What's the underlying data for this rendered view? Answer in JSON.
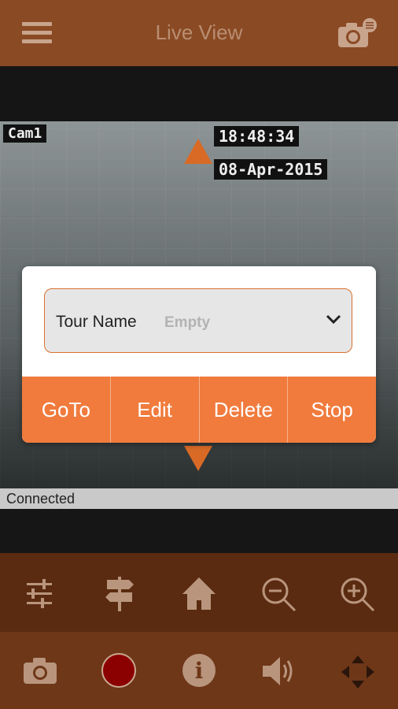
{
  "header": {
    "title": "Live View",
    "menu_icon": "hamburger-menu-icon",
    "camera_settings_icon": "camera-settings-icon"
  },
  "video": {
    "camera_name": "Cam1",
    "time": "18:48:34",
    "date": "08-Apr-2015"
  },
  "status": {
    "text": "Connected"
  },
  "dialog": {
    "tour_label": "Tour Name",
    "tour_value": "Empty",
    "buttons": {
      "goto": "GoTo",
      "edit": "Edit",
      "delete": "Delete",
      "stop": "Stop"
    }
  },
  "toolbar_top": [
    "sliders-icon",
    "signpost-icon",
    "home-icon",
    "zoom-out-icon",
    "zoom-in-icon"
  ],
  "toolbar_bottom": [
    "snapshot-camera-icon",
    "record-icon",
    "info-icon",
    "speaker-icon",
    "move-arrows-icon"
  ],
  "colors": {
    "header": "#8a4a24",
    "accent": "#f07b3d",
    "toolbar_top": "#5a2b10",
    "toolbar_bottom": "#6e3718",
    "record": "#8b0000"
  }
}
